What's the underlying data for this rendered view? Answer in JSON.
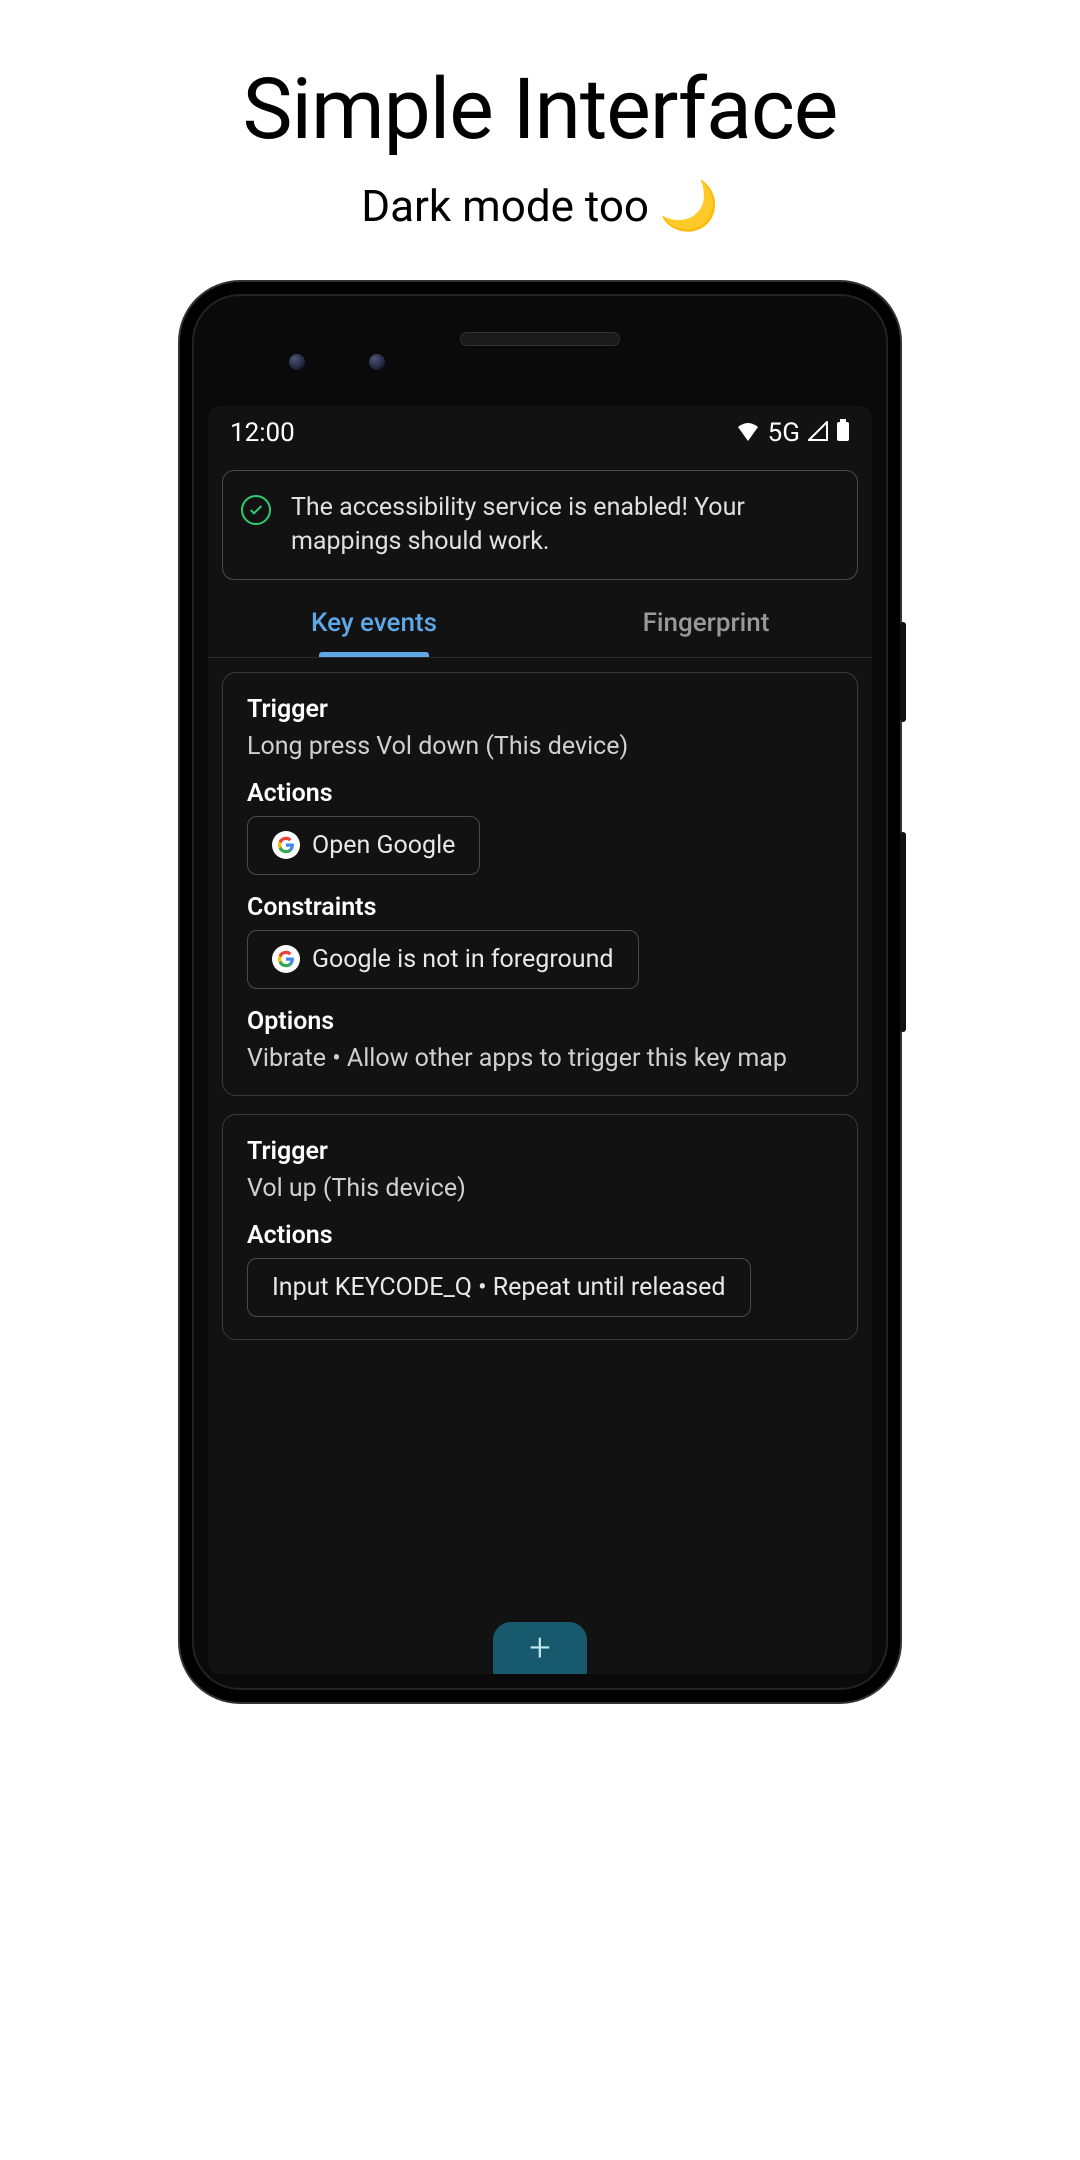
{
  "header": {
    "title": "Simple Interface",
    "subtitle": "Dark mode too"
  },
  "statusBar": {
    "time": "12:00",
    "network": "5G"
  },
  "banner": {
    "text": "The accessibility service is enabled! Your mappings should work."
  },
  "tabs": {
    "keyEvents": "Key events",
    "fingerprint": "Fingerprint"
  },
  "cards": [
    {
      "triggerLabel": "Trigger",
      "triggerValue": "Long press Vol down (This device)",
      "actionsLabel": "Actions",
      "actionChip": "Open Google",
      "constraintsLabel": "Constraints",
      "constraintChip": "Google is not in foreground",
      "optionsLabel": "Options",
      "optionsValue": "Vibrate • Allow other apps to trigger this key map"
    },
    {
      "triggerLabel": "Trigger",
      "triggerValue": "Vol up (This device)",
      "actionsLabel": "Actions",
      "actionChip": "Input KEYCODE_Q • Repeat until released"
    }
  ],
  "fab": {
    "label": "+"
  }
}
